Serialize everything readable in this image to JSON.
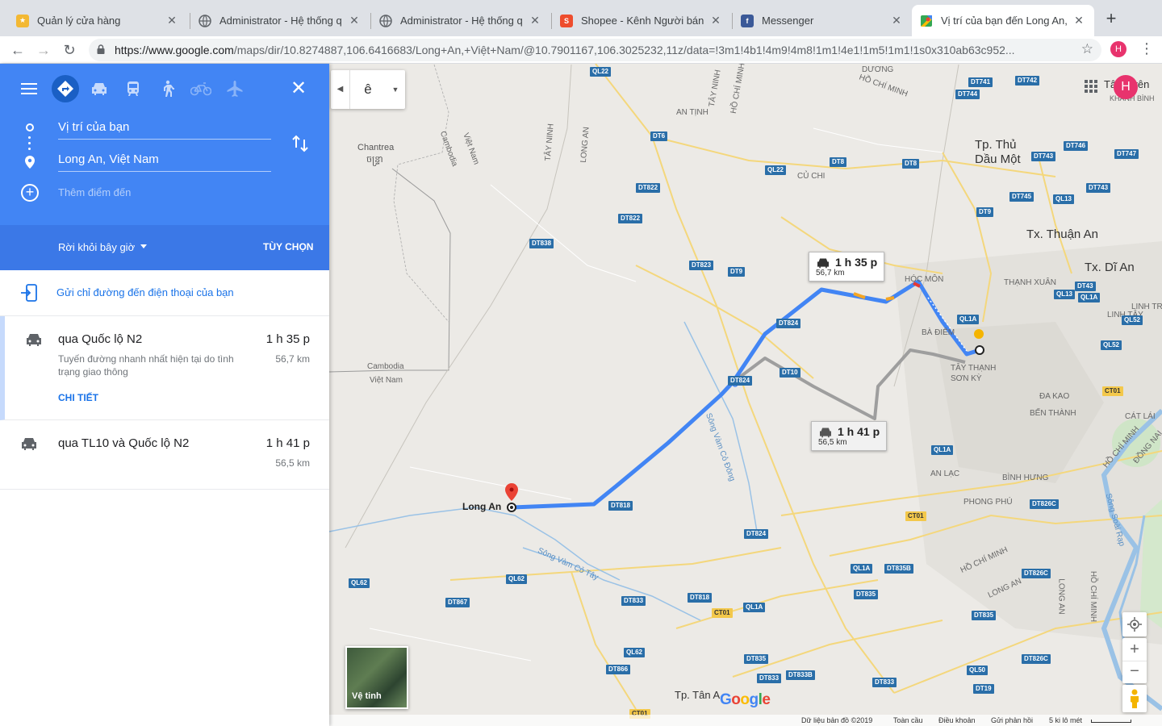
{
  "browser": {
    "tabs": [
      {
        "title": "Quản lý cửa hàng",
        "favicon": "store-icon",
        "color": "#f3b833",
        "active": false
      },
      {
        "title": "Administrator - Hệ thống qu",
        "favicon": "globe-icon",
        "color": "#5f6368",
        "active": false
      },
      {
        "title": "Administrator - Hệ thống qu",
        "favicon": "globe-icon",
        "color": "#5f6368",
        "active": false
      },
      {
        "title": "Shopee - Kênh Người bán",
        "favicon": "shopee-icon",
        "color": "#ee4d2d",
        "active": false
      },
      {
        "title": "Messenger",
        "favicon": "facebook-icon",
        "color": "#3b5998",
        "active": false
      },
      {
        "title": "Vị trí của bạn đến Long An, V",
        "favicon": "google-maps-icon",
        "color": "#34a853",
        "active": true
      }
    ],
    "url_domain": "https://www.google.com",
    "url_path": "/maps/dir/10.8274887,106.6416683/Long+An,+Việt+Nam/@10.7901167,106.3025232,11z/data=!3m1!4b1!4m9!4m8!1m1!4e1!1m5!1m1!1s0x310ab63c952...",
    "profile_initial": "H",
    "profile_color": "#e8336d"
  },
  "panel": {
    "header_color": "#4285f4",
    "origin": "Vị trí của bạn",
    "destination": "Long An, Việt Nam",
    "add_destination": "Thêm điểm đến",
    "leave_now": "Rời khỏi bây giờ",
    "options": "TÙY CHỌN",
    "send_to_phone": "Gửi chỉ đường đến điện thoại của bạn",
    "routes": [
      {
        "via": "qua Quốc lộ N2",
        "duration": "1 h 35 p",
        "distance": "56,7 km",
        "description": "Tuyến đường nhanh nhất hiện tại do tình trạng giao thông",
        "details_link": "CHI TIẾT",
        "selected": true
      },
      {
        "via": "qua TL10 và Quốc lộ N2",
        "duration": "1 h 41 p",
        "distance": "56,5 km",
        "selected": false
      }
    ]
  },
  "map": {
    "layer_label": "ê",
    "satellite_label": "Vệ tinh",
    "callout_primary": {
      "duration": "1 h 35 p",
      "distance": "56,7 km"
    },
    "callout_alt": {
      "duration": "1 h 41 p",
      "distance": "56,5 km"
    },
    "route_color": "#4285f4",
    "alt_route_color": "#9e9e9e",
    "destination_label": "Long An",
    "places": {
      "chantrea": "Chantrea",
      "chantrea_khmer": "ចន្ទ្រា",
      "cambodia": "Cambodia",
      "viet_nam": "Việt Nam",
      "cambodia_2": "Cambodia",
      "viet_nam_2": "Việt Nam",
      "tp_thu_dau_mot_1": "Tp. Thủ",
      "tp_thu_dau_mot_2": "Dầu Một",
      "tx_thuan_an": "Tx. Thuận An",
      "tx_di_an": "Tx. Dĩ An",
      "hoc_mon": "HÓC MÔN",
      "ba_diem": "BÀ ĐIỂM",
      "tay_thanh": "TÂY THẠNH",
      "son_ky": "SƠN KỲ",
      "da_kao": "ĐA KAO",
      "ben_thanh": "BẾN THÀNH",
      "an_lac": "AN LẠC",
      "binh_hung": "BÌNH HƯNG",
      "phong_phu": "PHONG PHÚ",
      "an_tinh": "AN TỊNH",
      "cu_chi": "CỦ CHI",
      "thanh_xuan": "THẠNH XUÂN",
      "linh_trung": "LINH TRUNG",
      "linh_tay": "LINH TÂY",
      "cat_lai": "CÁT LÁI",
      "dong_nai": "ĐỒNG NAI",
      "tay_ninh": "TÂY NINH",
      "tay_ninh_2": "TÂY NINH",
      "long_an": "LONG AN",
      "long_an_2": "LONG AN",
      "long_an_3": "LONG AN",
      "ho_chi_minh_1": "HỒ CHÍ MINH",
      "ho_chi_minh_2": "HỒ CHÍ MINH",
      "ho_chi_minh_3": "HỒ CHÍ MINH",
      "ho_chi_minh_4": "HỒ CHÍ MINH",
      "ho_chi_minh_5": "HỒ CHÍ MINH",
      "duong": "DƯƠNG",
      "song_vam_co_dong": "Sông Vàm Cỏ Đông",
      "song_vam_co_tay": "Sông Vàm Cỏ Tây",
      "song_soai_rap": "Sông Soài Rạp",
      "tp_tan_an": "Tp. Tân A",
      "tan_uyen": "Tân Uyên",
      "khanh_binh": "KHÁNH BÌNH"
    },
    "shields": {
      "ql22a": "QL22",
      "ql22b": "QL22",
      "dt6": "DT6",
      "dt8a": "DT8",
      "dt8b": "DT8",
      "dt822a": "DT822",
      "dt822b": "DT822",
      "dt838": "DT838",
      "dt823": "DT823",
      "dt9a": "DT9",
      "dt9b": "DT9",
      "dt824a": "DT824",
      "dt824b": "DT824",
      "dt824c": "DT824",
      "dt10": "DT10",
      "dt818a": "DT818",
      "dt818b": "DT818",
      "dt741": "DT741",
      "dt742": "DT742",
      "dt744": "DT744",
      "dt746": "DT746",
      "dt747": "DT747",
      "dt743a": "DT743",
      "dt743b": "DT743",
      "dt745": "DT745",
      "ql13a": "QL13",
      "ql13b": "QL13",
      "dt43": "DT43",
      "ql1aa": "QL1A",
      "ql1ab": "QL1A",
      "ql1ac": "QL1A",
      "ql1ad": "QL1A",
      "ql1ae": "QL1A",
      "ql52a": "QL52",
      "ql52b": "QL52",
      "ct01a": "CT01",
      "ct01b": "CT01",
      "ct01c": "CT01",
      "ct01d": "CT01",
      "dt826ca": "DT826C",
      "dt826cb": "DT826C",
      "dt826cc": "DT826C",
      "dt835a": "DT835",
      "dt835b": "DT835",
      "dt835c": "DT835",
      "dt835ba": "DT835B",
      "ql62a": "QL62",
      "ql62b": "QL62",
      "ql62c": "QL62",
      "dt867": "DT867",
      "dt833a": "DT833",
      "dt833b": "DT833",
      "dt833c": "DT833",
      "dt833ba": "DT833B",
      "dt866": "DT866",
      "ql50": "QL50",
      "dt19": "DT19"
    },
    "footer": {
      "data": "Dữ liệu bản đồ ©2019",
      "global": "Toàn cầu",
      "terms": "Điều khoản",
      "feedback": "Gửi phản hồi",
      "scale": "5 ki lô mét"
    }
  }
}
